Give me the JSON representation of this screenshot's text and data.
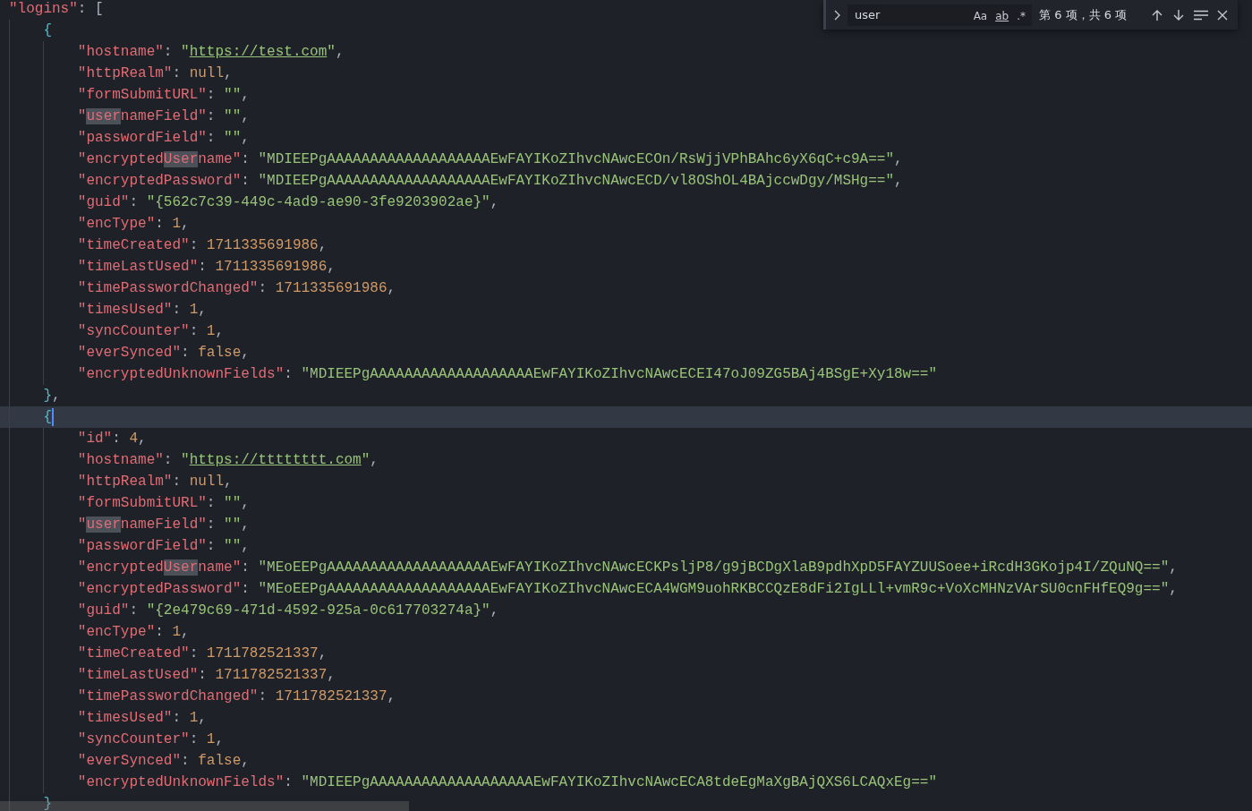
{
  "editor": {
    "lines": [
      {
        "text": "\"logins\": [",
        "current": false
      },
      {
        "text": "    {",
        "current": false
      },
      {
        "text": "        \"hostname\": \"https://test.com\",",
        "current": false
      },
      {
        "text": "        \"httpRealm\": null,",
        "current": false
      },
      {
        "text": "        \"formSubmitURL\": \"\",",
        "current": false
      },
      {
        "text": "        \"usernameField\": \"\",",
        "current": false
      },
      {
        "text": "        \"passwordField\": \"\",",
        "current": false
      },
      {
        "text": "        \"encryptedUsername\": \"MDIEEPgAAAAAAAAAAAAAAAAAAAEwFAYIKoZIhvcNAwcECOn/RsWjjVPhBAhc6yX6qC+c9A==\",",
        "current": false
      },
      {
        "text": "        \"encryptedPassword\": \"MDIEEPgAAAAAAAAAAAAAAAAAAAEwFAYIKoZIhvcNAwcECD/vl8OShOL4BAjccwDgy/MSHg==\",",
        "current": false
      },
      {
        "text": "        \"guid\": \"{562c7c39-449c-4ad9-ae90-3fe9203902ae}\",",
        "current": false
      },
      {
        "text": "        \"encType\": 1,",
        "current": false
      },
      {
        "text": "        \"timeCreated\": 1711335691986,",
        "current": false
      },
      {
        "text": "        \"timeLastUsed\": 1711335691986,",
        "current": false
      },
      {
        "text": "        \"timePasswordChanged\": 1711335691986,",
        "current": false
      },
      {
        "text": "        \"timesUsed\": 1,",
        "current": false
      },
      {
        "text": "        \"syncCounter\": 1,",
        "current": false
      },
      {
        "text": "        \"everSynced\": false,",
        "current": false
      },
      {
        "text": "        \"encryptedUnknownFields\": \"MDIEEPgAAAAAAAAAAAAAAAAAAAEwFAYIKoZIhvcNAwcECEI47oJ09ZG5BAj4BSgE+Xy18w==\"",
        "current": false
      },
      {
        "text": "    },",
        "current": false
      },
      {
        "text": "    {",
        "current": true
      },
      {
        "text": "        \"id\": 4,",
        "current": false
      },
      {
        "text": "        \"hostname\": \"https://tttttttt.com\",",
        "current": false
      },
      {
        "text": "        \"httpRealm\": null,",
        "current": false
      },
      {
        "text": "        \"formSubmitURL\": \"\",",
        "current": false
      },
      {
        "text": "        \"usernameField\": \"\",",
        "current": false
      },
      {
        "text": "        \"passwordField\": \"\",",
        "current": false
      },
      {
        "text": "        \"encryptedUsername\": \"MEoEEPgAAAAAAAAAAAAAAAAAAAEwFAYIKoZIhvcNAwcECKPsljP8/g9jBCDgXlaB9pdhXpD5FAYZUUSoee+iRcdH3GKojp4I/ZQuNQ==\",",
        "current": false
      },
      {
        "text": "        \"encryptedPassword\": \"MEoEEPgAAAAAAAAAAAAAAAAAAAEwFAYIKoZIhvcNAwcECA4WGM9uohRKBCCQzE8dFi2IgLLl+vmR9c+VoXcMHNzVArSU0cnFHfEQ9g==\",",
        "current": false
      },
      {
        "text": "        \"guid\": \"{2e479c69-471d-4592-925a-0c617703274a}\",",
        "current": false
      },
      {
        "text": "        \"encType\": 1,",
        "current": false
      },
      {
        "text": "        \"timeCreated\": 1711782521337,",
        "current": false
      },
      {
        "text": "        \"timeLastUsed\": 1711782521337,",
        "current": false
      },
      {
        "text": "        \"timePasswordChanged\": 1711782521337,",
        "current": false
      },
      {
        "text": "        \"timesUsed\": 1,",
        "current": false
      },
      {
        "text": "        \"syncCounter\": 1,",
        "current": false
      },
      {
        "text": "        \"everSynced\": false,",
        "current": false
      },
      {
        "text": "        \"encryptedUnknownFields\": \"MDIEEPgAAAAAAAAAAAAAAAAAAAEwFAYIKoZIhvcNAwcECA8tdeEgMaXgBAjQXS6LCAQxEg==\"",
        "current": false
      },
      {
        "text": "    }",
        "current": false
      }
    ]
  },
  "find_widget": {
    "expanded": false,
    "value": "user",
    "options": [
      {
        "label": "Aa",
        "on": false
      },
      {
        "label": "ab",
        "on": false
      },
      {
        "label": ".*",
        "on": false
      }
    ],
    "result": "第 6 项，共 6 项"
  }
}
